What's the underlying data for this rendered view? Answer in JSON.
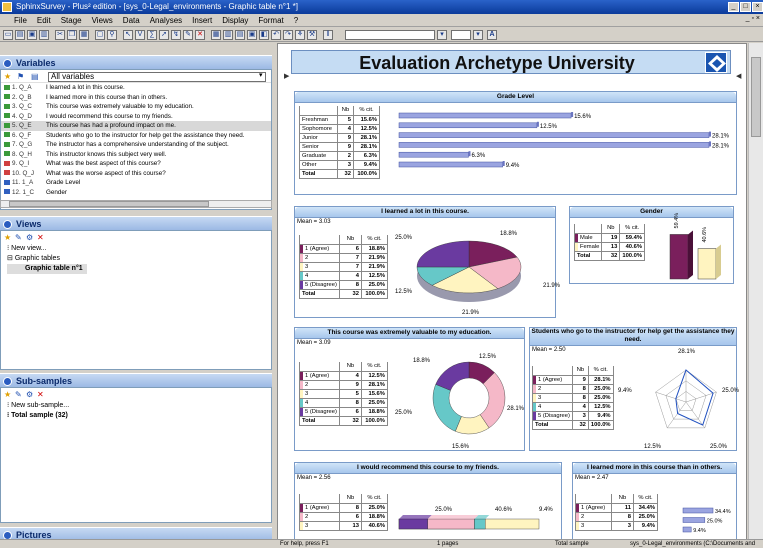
{
  "window": {
    "title": "SphinxSurvey - Plus² edition - [sys_0-Legal_environments - Graphic table n°1 *]",
    "controls": [
      "_",
      "□",
      "×"
    ]
  },
  "menu": [
    "File",
    "Edit",
    "Stage",
    "Views",
    "Data",
    "Analyses",
    "Insert",
    "Display",
    "Format",
    "?"
  ],
  "toolbar": {
    "select1": "",
    "select2": "",
    "font_button": "A"
  },
  "variables_panel": {
    "title": "Variables",
    "filter": "All variables",
    "items": [
      {
        "code": "1. Q_A",
        "label": "I learned a lot in this course.",
        "type": "scale"
      },
      {
        "code": "2. Q_B",
        "label": "I learned more in this course than in others.",
        "type": "scale"
      },
      {
        "code": "3. Q_C",
        "label": "This course was extremely valuable to my education.",
        "type": "scale"
      },
      {
        "code": "4. Q_D",
        "label": "I would recommend this course to my friends.",
        "type": "scale"
      },
      {
        "code": "5. Q_E",
        "label": "This course has had a profound impact on me.",
        "type": "scale",
        "selected": true
      },
      {
        "code": "6. Q_F",
        "label": "Students who go to the instructor for help get the assistance they need.",
        "type": "scale"
      },
      {
        "code": "7. Q_G",
        "label": "The instructor has a comprehensive understanding of the subject.",
        "type": "scale"
      },
      {
        "code": "8. Q_H",
        "label": "This instructor knows this subject very well.",
        "type": "scale"
      },
      {
        "code": "9. Q_I",
        "label": "What was the best aspect of this course?",
        "type": "text"
      },
      {
        "code": "10. Q_J",
        "label": "What was the worse aspect of this course?",
        "type": "text"
      },
      {
        "code": "11. 1_A",
        "label": "Grade Level",
        "type": "closed"
      },
      {
        "code": "12. 1_C",
        "label": "Gender",
        "type": "closed"
      }
    ]
  },
  "views_panel": {
    "title": "Views",
    "items": [
      "New view...",
      "Graphic tables",
      "Graphic table n°1"
    ]
  },
  "subsamples_panel": {
    "title": "Sub-samples",
    "items": [
      "New sub-sample...",
      "Total sample (32)"
    ]
  },
  "pictures_panel": {
    "title": "Pictures"
  },
  "document": {
    "banner": "Evaluation Archetype University",
    "col_nb": "Nb",
    "col_pct": "% cit.",
    "total_label": "Total",
    "tables": {
      "grade": {
        "title": "Grade Level",
        "rows": [
          [
            "Freshman",
            "5",
            "15.6%"
          ],
          [
            "Sophomore",
            "4",
            "12.5%"
          ],
          [
            "Junior",
            "9",
            "28.1%"
          ],
          [
            "Senior",
            "9",
            "28.1%"
          ],
          [
            "Graduate",
            "2",
            "6.3%"
          ],
          [
            "Other",
            "3",
            "9.4%"
          ]
        ],
        "total": [
          "32",
          "100.0%"
        ],
        "bar_labels": [
          "15.6%",
          "12.5%",
          "28.1%",
          "28.1%",
          "6.3%",
          "9.4%"
        ]
      },
      "learned": {
        "title": "I learned a lot in this course.",
        "mean": "Mean = 3.03",
        "rows": [
          [
            "1 (Agree)",
            "6",
            "18.8%"
          ],
          [
            "2",
            "7",
            "21.9%"
          ],
          [
            "3",
            "7",
            "21.9%"
          ],
          [
            "4",
            "4",
            "12.5%"
          ],
          [
            "5 (Disagree)",
            "8",
            "25.0%"
          ]
        ],
        "total": [
          "32",
          "100.0%"
        ],
        "pie_labels": [
          "18.8%",
          "21.9%",
          "21.9%",
          "12.5%",
          "25.0%"
        ]
      },
      "gender": {
        "title": "Gender",
        "rows": [
          [
            "Male",
            "19",
            "59.4%"
          ],
          [
            "Female",
            "13",
            "40.6%"
          ]
        ],
        "total": [
          "32",
          "100.0%"
        ],
        "bar_labels": [
          "59.4%",
          "40.6%"
        ]
      },
      "valuable": {
        "title": "This course was extremely valuable to my education.",
        "mean": "Mean = 3.09",
        "rows": [
          [
            "1 (Agree)",
            "4",
            "12.5%"
          ],
          [
            "2",
            "9",
            "28.1%"
          ],
          [
            "3",
            "5",
            "15.6%"
          ],
          [
            "4",
            "8",
            "25.0%"
          ],
          [
            "5 (Disagree)",
            "6",
            "18.8%"
          ]
        ],
        "total": [
          "32",
          "100.0%"
        ],
        "donut_labels": [
          "12.5%",
          "28.1%",
          "15.6%",
          "25.0%",
          "18.8%"
        ]
      },
      "instructor": {
        "title": "Students who go to the instructor for help get the assistance they need.",
        "mean": "Mean = 2.50",
        "rows": [
          [
            "1 (Agree)",
            "9",
            "28.1%"
          ],
          [
            "2",
            "8",
            "25.0%"
          ],
          [
            "3",
            "8",
            "25.0%"
          ],
          [
            "4",
            "4",
            "12.5%"
          ],
          [
            "5 (Disagree)",
            "3",
            "9.4%"
          ]
        ],
        "total": [
          "32",
          "100.0%"
        ],
        "radar_labels": [
          "28.1%",
          "25.0%",
          "25.0%",
          "12.5%",
          "9.4%"
        ]
      },
      "recommend": {
        "title": "I would recommend this course to my friends.",
        "mean": "Mean = 2.56",
        "rows": [
          [
            "1 (Agree)",
            "8",
            "25.0%"
          ],
          [
            "2",
            "6",
            "18.8%"
          ],
          [
            "3",
            "13",
            "40.6%"
          ]
        ],
        "bar_labels": [
          "25.0%",
          "40.6%",
          "9.4%"
        ]
      },
      "more": {
        "title": "I learned more in this course than in others.",
        "mean": "Mean = 2.47",
        "rows": [
          [
            "1 (Agree)",
            "11",
            "34.4%"
          ],
          [
            "2",
            "8",
            "25.0%"
          ],
          [
            "3",
            "3",
            "9.4%"
          ]
        ],
        "bar_labels": [
          "34.4%",
          "25.0%",
          "9.4%"
        ]
      }
    }
  },
  "chart_data": [
    {
      "type": "bar",
      "title": "Grade Level",
      "categories": [
        "Freshman",
        "Sophomore",
        "Junior",
        "Senior",
        "Graduate",
        "Other"
      ],
      "values": [
        15.6,
        12.5,
        28.1,
        28.1,
        6.3,
        9.4
      ],
      "orientation": "horizontal"
    },
    {
      "type": "pie",
      "title": "I learned a lot in this course.",
      "categories": [
        "1 (Agree)",
        "2",
        "3",
        "4",
        "5 (Disagree)"
      ],
      "values": [
        18.8,
        21.9,
        21.9,
        12.5,
        25.0
      ]
    },
    {
      "type": "bar",
      "title": "Gender",
      "categories": [
        "Male",
        "Female"
      ],
      "values": [
        59.4,
        40.6
      ]
    },
    {
      "type": "pie",
      "title": "This course was extremely valuable to my education.",
      "categories": [
        "1 (Agree)",
        "2",
        "3",
        "4",
        "5 (Disagree)"
      ],
      "values": [
        12.5,
        28.1,
        15.6,
        25.0,
        18.8
      ]
    },
    {
      "type": "radar",
      "title": "Students who go to the instructor for help get the assistance they need.",
      "categories": [
        "1 (Agree)",
        "2",
        "3",
        "4",
        "5 (Disagree)"
      ],
      "values": [
        28.1,
        25.0,
        25.0,
        12.5,
        9.4
      ]
    },
    {
      "type": "bar",
      "title": "I would recommend this course to my friends.",
      "categories": [
        "1 (Agree)",
        "2",
        "3"
      ],
      "values": [
        25.0,
        40.6,
        9.4
      ],
      "stacked": true
    },
    {
      "type": "bar",
      "title": "I learned more in this course than in others.",
      "categories": [
        "1 (Agree)",
        "2",
        "3"
      ],
      "values": [
        34.4,
        25.0,
        9.4
      ],
      "orientation": "horizontal"
    }
  ],
  "colors": {
    "s1": "#7a1f5c",
    "s2": "#f5b8c8",
    "s3": "#fff4c0",
    "s4": "#66c8c8",
    "s5": "#6a3aa0",
    "bar": "#9aa4e0",
    "pane": "#c5dcf3"
  },
  "statusbar": {
    "help": "For help, press F1",
    "pages": "1 pages",
    "sample": "Total sample",
    "path": "sys_0-Legal_environments (C:\\Documents and"
  }
}
